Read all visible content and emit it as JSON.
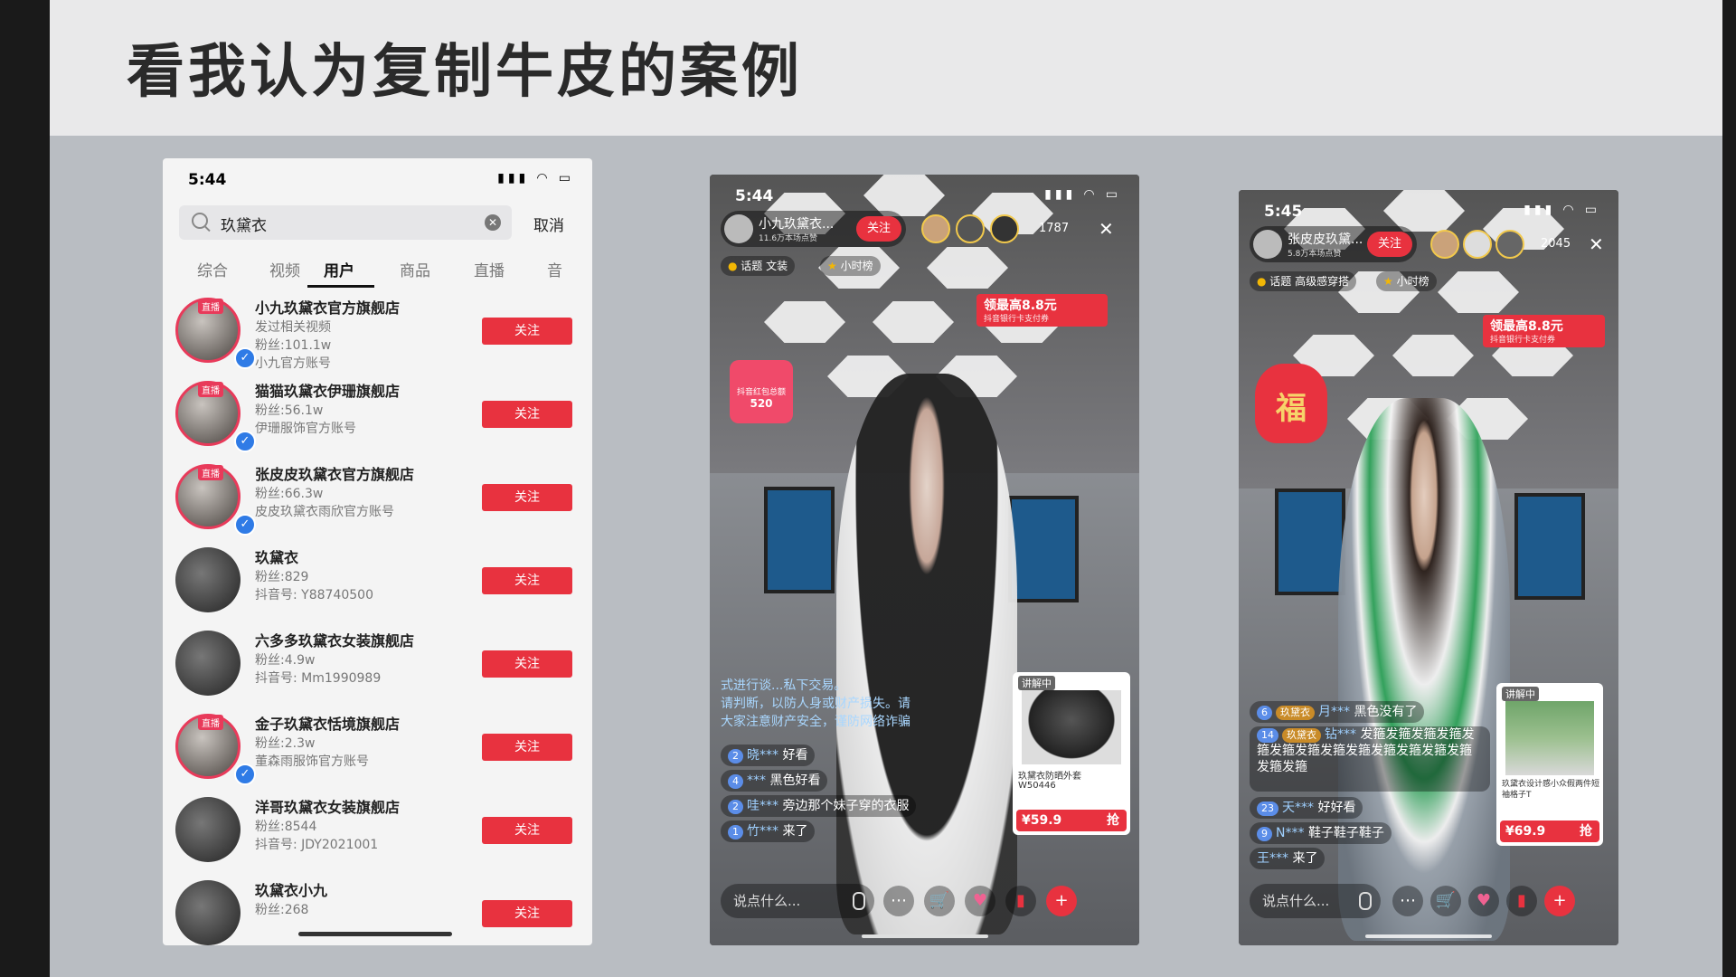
{
  "slide": {
    "title": "看我认为复制牛皮的案例"
  },
  "search_screen": {
    "time": "5:44",
    "query": "玖黛衣",
    "cancel": "取消",
    "tabs": [
      "综合",
      "视频",
      "用户",
      "商品",
      "直播",
      "音"
    ],
    "active_tab": "用户",
    "live_tag": "直播",
    "follow_label": "关注",
    "results": [
      {
        "name": "小九玖黛衣官方旗舰店",
        "line1": "发过相关视频",
        "line2": "粉丝:101.1w",
        "line3": "小九官方账号"
      },
      {
        "name": "猫猫玖黛衣伊珊旗舰店",
        "line1": "粉丝:56.1w",
        "line2": "伊珊服饰官方账号"
      },
      {
        "name": "张皮皮玖黛衣官方旗舰店",
        "line1": "粉丝:66.3w",
        "line2": "皮皮玖黛衣雨欣官方账号"
      },
      {
        "name": "玖黛衣",
        "line1": "粉丝:829",
        "line2": "抖音号: Y88740500"
      },
      {
        "name": "六多多玖黛衣女装旗舰店",
        "line1": "粉丝:4.9w",
        "line2": "抖音号: Mm1990989"
      },
      {
        "name": "金子玖黛衣恬境旗舰店",
        "line1": "粉丝:2.3w",
        "line2": "董森雨服饰官方账号"
      },
      {
        "name": "洋哥玖黛衣女装旗舰店",
        "line1": "粉丝:8544",
        "line2": "抖音号: JDY2021001"
      },
      {
        "name": "玖黛衣小九",
        "line1": "粉丝:268"
      }
    ]
  },
  "live_a": {
    "time": "5:44",
    "host_name": "小九玖黛衣...",
    "host_likes": "11.6万本场点赞",
    "follow": "关注",
    "viewer_count": "1787",
    "tags": [
      "话题 文装",
      "小时榜"
    ],
    "coupon_title": "领最高8.8元",
    "coupon_sub": "抖音银行卡支付券",
    "gift_text": "抖音红包总额",
    "gift_amount": "520",
    "notice": [
      "式进行谈...私下交易。",
      "请判断，以防人身或财产损失。请",
      "大家注意财产安全，谨防网络诈骗"
    ],
    "chat": [
      {
        "level": "2",
        "user": "晓***",
        "text": "好看"
      },
      {
        "level": "4",
        "user": "***",
        "text": "黑色好看"
      },
      {
        "level": "2",
        "user": "哇***",
        "text": "旁边那个妹子穿的衣服"
      },
      {
        "level": "1",
        "user": "竹***",
        "text": "来了"
      }
    ],
    "product": {
      "badge": "讲解中",
      "name": "玖黛衣防晒外套",
      "code": "W50446",
      "price": "¥59.9",
      "buy": "抢"
    },
    "say": "说点什么..."
  },
  "live_b": {
    "time": "5:45",
    "host_name": "张皮皮玖黛...",
    "host_likes": "5.8万本场点赞",
    "follow": "关注",
    "viewer_count": "2045",
    "tags": [
      "话题 高级感穿搭",
      "小时榜"
    ],
    "coupon_title": "领最高8.8元",
    "coupon_sub": "抖音银行卡支付券",
    "fu": "福",
    "chat": [
      {
        "level": "6",
        "badge": "玖黛衣",
        "user": "月***",
        "text": "黑色没有了"
      },
      {
        "level": "14",
        "badge": "玖黛衣",
        "user": "钻***",
        "text": "发箍发箍发箍发箍发箍发箍发箍发箍发箍发箍发箍发箍发箍发箍发箍"
      },
      {
        "level": "23",
        "user": "天***",
        "text": "好好看"
      },
      {
        "level": "9",
        "user": "N***",
        "text": "鞋子鞋子鞋子"
      },
      {
        "level": "",
        "user": "王***",
        "text": "来了"
      }
    ],
    "product": {
      "badge": "讲解中",
      "name": "玖黛衣设计感小众假两件短袖格子T",
      "price": "¥69.9",
      "buy": "抢"
    },
    "say": "说点什么..."
  }
}
